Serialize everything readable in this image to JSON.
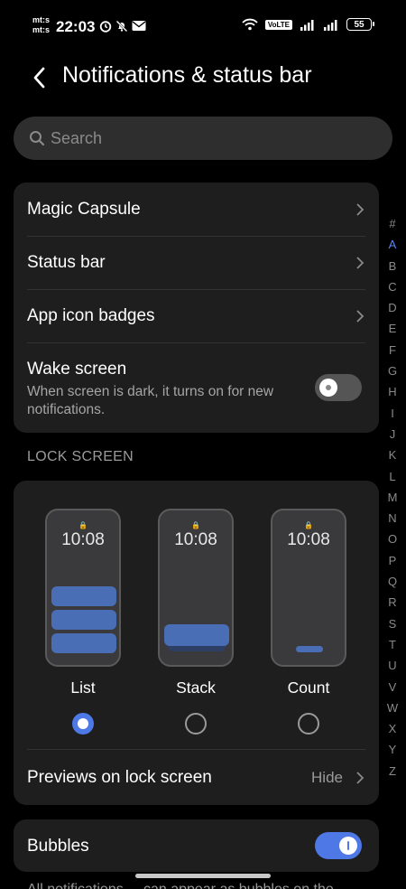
{
  "status_bar": {
    "carrier_line1": "mt:s",
    "carrier_line2": "mt:s",
    "time": "22:03",
    "volte": "VoLTE",
    "battery": "55"
  },
  "header": {
    "title": "Notifications & status bar"
  },
  "search": {
    "placeholder": "Search"
  },
  "settings": {
    "magic_capsule": "Magic Capsule",
    "status_bar": "Status bar",
    "app_icon_badges": "App icon badges",
    "wake_screen": {
      "label": "Wake screen",
      "description": "When screen is dark, it turns on for new notifications.",
      "enabled": false
    }
  },
  "lock_screen": {
    "section_title": "LOCK SCREEN",
    "styles": [
      {
        "label": "List",
        "time": "10:08",
        "selected": true
      },
      {
        "label": "Stack",
        "time": "10:08",
        "selected": false
      },
      {
        "label": "Count",
        "time": "10:08",
        "selected": false
      }
    ],
    "previews": {
      "label": "Previews on lock screen",
      "value": "Hide"
    }
  },
  "bubbles": {
    "label": "Bubbles",
    "enabled": true,
    "description_partial": "All notifications ... can appear as bubbles on the"
  },
  "alphabet_index": [
    "#",
    "A",
    "B",
    "C",
    "D",
    "E",
    "F",
    "G",
    "H",
    "I",
    "J",
    "K",
    "L",
    "M",
    "N",
    "O",
    "P",
    "Q",
    "R",
    "S",
    "T",
    "U",
    "V",
    "W",
    "X",
    "Y",
    "Z"
  ],
  "alphabet_active": "A",
  "colors": {
    "accent": "#4d78e6",
    "card": "#1e1e1e",
    "background": "#000000"
  }
}
